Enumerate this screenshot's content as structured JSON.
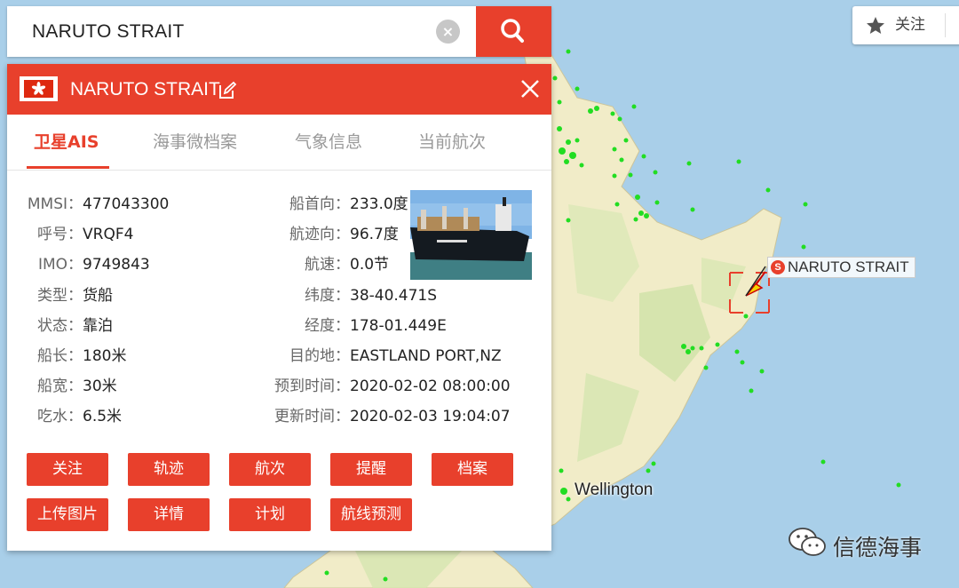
{
  "search": {
    "value": "NARUTO STRAIT"
  },
  "topbar": {
    "follow_label": "关注"
  },
  "panel": {
    "title": "NARUTO STRAIT",
    "tabs": [
      "卫星AIS",
      "海事微档案",
      "气象信息",
      "当前航次"
    ],
    "left_fields": [
      {
        "label": "MMSI：",
        "value": "477043300"
      },
      {
        "label": "呼号：",
        "value": "VRQF4"
      },
      {
        "label": "IMO：",
        "value": "9749843"
      },
      {
        "label": "类型：",
        "value": "货船"
      },
      {
        "label": "状态：",
        "value": "靠泊"
      },
      {
        "label": "船长：",
        "value": "180米"
      },
      {
        "label": "船宽：",
        "value": "30米"
      },
      {
        "label": "吃水：",
        "value": "6.5米"
      }
    ],
    "right_fields": [
      {
        "label": "船首向：",
        "value": "233.0度"
      },
      {
        "label": "航迹向：",
        "value": "96.7度"
      },
      {
        "label": "航速：",
        "value": "0.0节"
      },
      {
        "label": "纬度：",
        "value": "38-40.471S"
      },
      {
        "label": "经度：",
        "value": "178-01.449E"
      },
      {
        "label": "目的地：",
        "value": "EASTLAND PORT,NZ"
      },
      {
        "label": "预到时间：",
        "value": "2020-02-02 08:00:00"
      },
      {
        "label": "更新时间：",
        "value": "2020-02-03 19:04:07"
      }
    ],
    "buttons_row1": [
      "关注",
      "轨迹",
      "航次",
      "提醒",
      "档案"
    ],
    "buttons_row2": [
      "上传图片",
      "详情",
      "计划",
      "航线预测"
    ]
  },
  "map": {
    "ship_label": "NARUTO STRAIT",
    "ship_badge": "S",
    "city_label": "Wellington",
    "watermark": "信德海事"
  },
  "colors": {
    "accent": "#e8402c",
    "land": "#f4efcf",
    "sea": "#a9cfe9",
    "vessel": "#22dd22"
  },
  "icons": [
    "search-icon",
    "clear-icon",
    "star-icon",
    "close-icon",
    "edit-icon",
    "hk-flag-icon",
    "wechat-icon"
  ]
}
